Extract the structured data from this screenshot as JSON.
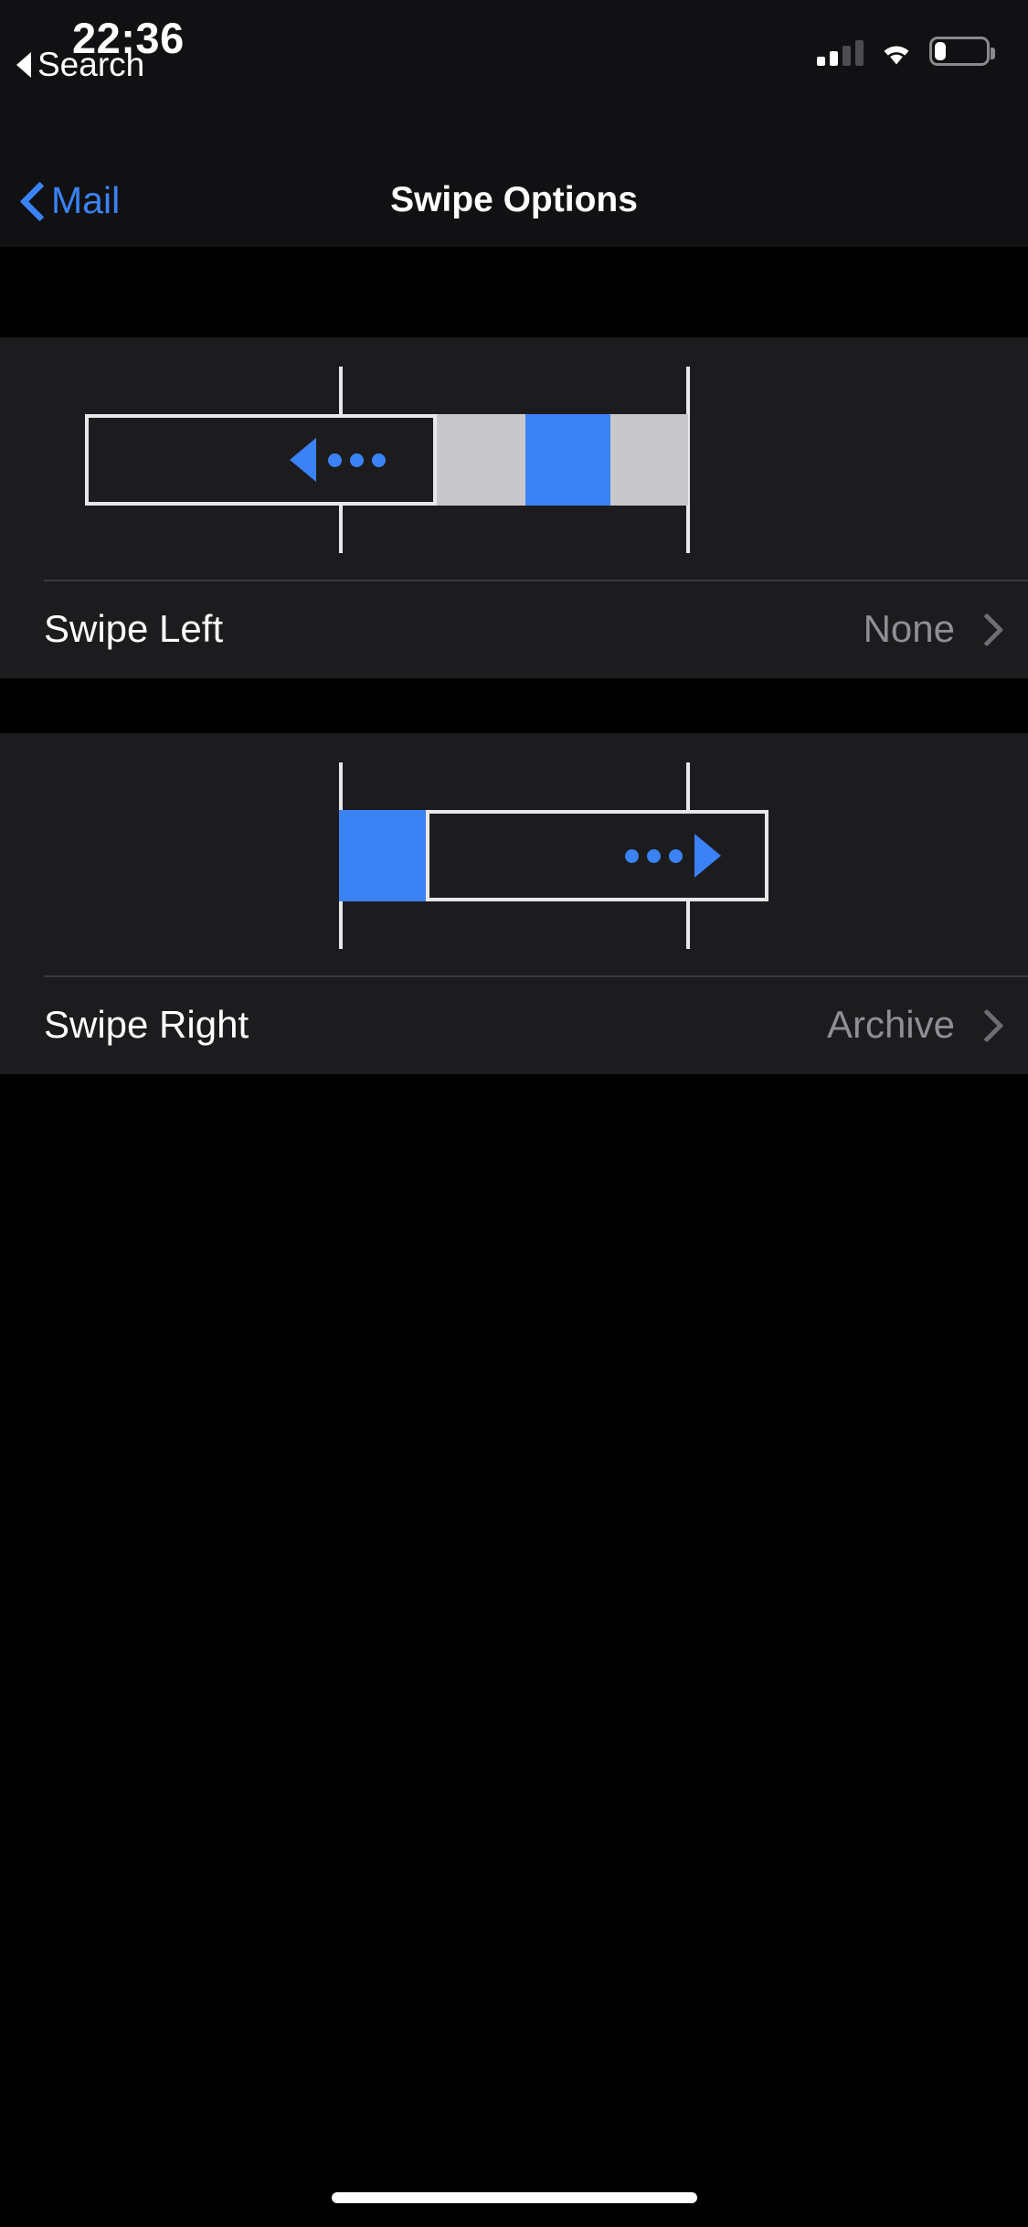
{
  "status_bar": {
    "time": "22:36",
    "return_app_label": "Search",
    "return_icon": "back-triangle-icon",
    "signal_icon": "cellular-signal-icon",
    "signal_bars_active": 2,
    "signal_bars_total": 4,
    "wifi_icon": "wifi-icon",
    "battery_icon": "battery-low-icon",
    "battery_percent": 15
  },
  "nav_bar": {
    "back_label": "Mail",
    "back_icon": "chevron-left-icon",
    "title": "Swipe Options"
  },
  "sections": [
    {
      "illustration": {
        "name": "swipe-left-illustration",
        "direction": "left",
        "arrow_icon": "triangle-left-icon",
        "dots_icon": "ellipsis-icon",
        "segment_colors": [
          "#c8c8cc",
          "#3b82f6",
          "#c8c8cc"
        ]
      },
      "row": {
        "label": "Swipe Left",
        "value": "None",
        "chevron_icon": "chevron-right-icon"
      }
    },
    {
      "illustration": {
        "name": "swipe-right-illustration",
        "direction": "right",
        "arrow_icon": "triangle-right-icon",
        "dots_icon": "ellipsis-icon",
        "segment_colors": [
          "#3b82f6"
        ]
      },
      "row": {
        "label": "Swipe Right",
        "value": "Archive",
        "chevron_icon": "chevron-right-icon"
      }
    }
  ],
  "home_indicator": {
    "name": "home-indicator"
  },
  "colors": {
    "accent_blue": "#3b82f6",
    "background": "#000000",
    "card": "#1c1c1e",
    "separator": "#39393c",
    "secondary_label": "#8e8e93",
    "action_gray": "#c8c8cc"
  }
}
